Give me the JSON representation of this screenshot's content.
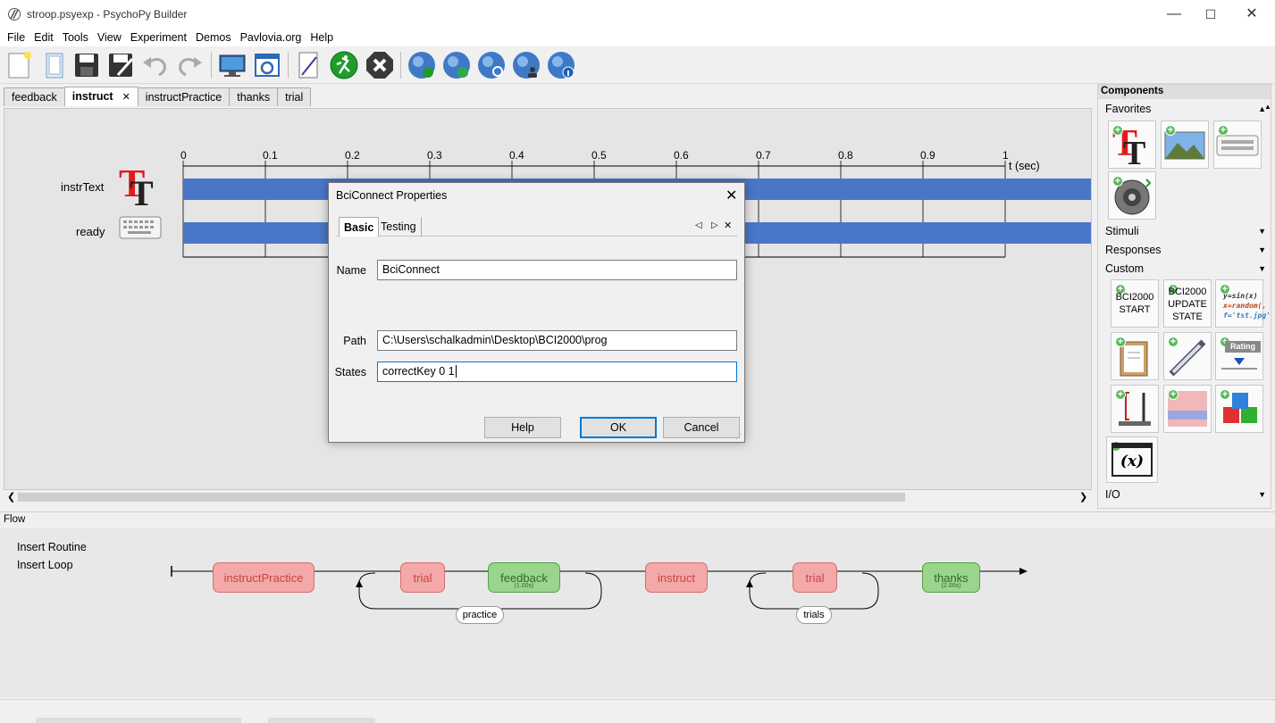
{
  "window": {
    "title": "stroop.psyexp - PsychoPy Builder",
    "min": "—",
    "max": "☐",
    "close": "✕"
  },
  "menu": [
    "File",
    "Edit",
    "Tools",
    "View",
    "Experiment",
    "Demos",
    "Pavlovia.org",
    "Help"
  ],
  "toolbar": [
    "new-file",
    "open-file",
    "save",
    "save-as",
    "undo",
    "redo",
    "monitor-center",
    "experiment-settings",
    "compile-script",
    "run",
    "stop",
    "pavlovia-sync",
    "pavlovia-search",
    "pavlovia-upload",
    "pavlovia-user",
    "pavlovia-info"
  ],
  "routine_tabs": [
    {
      "label": "feedback",
      "active": false
    },
    {
      "label": "instruct",
      "active": true,
      "close": "✕"
    },
    {
      "label": "instructPractice",
      "active": false
    },
    {
      "label": "thanks",
      "active": false
    },
    {
      "label": "trial",
      "active": false
    }
  ],
  "timeline": {
    "ticks": [
      "0",
      "0.1",
      "0.2",
      "0.3",
      "0.4",
      "0.5",
      "0.6",
      "0.7",
      "0.8",
      "0.9",
      "1"
    ],
    "unit_label": "t (sec)",
    "components": [
      {
        "name": "instrText",
        "icon": "text-icon"
      },
      {
        "name": "ready",
        "icon": "keyboard-icon"
      }
    ],
    "bar_color": "#4a76c8"
  },
  "components_panel": {
    "header": "Components",
    "categories": {
      "favorites": "Favorites",
      "stimuli": "Stimuli",
      "responses": "Responses",
      "custom": "Custom",
      "io": "I/O"
    },
    "bci_start": [
      "BCI2000",
      "START"
    ],
    "bci_update": [
      "BCI2000",
      "UPDATE",
      "STATE"
    ],
    "code_text": [
      "y=sin(x)",
      "x=random(,",
      "f='tst.jpg'"
    ],
    "rating_label": "Rating",
    "variable_label": "(x)"
  },
  "flow": {
    "header": "Flow",
    "insert_routine": "Insert Routine",
    "insert_loop": "Insert Loop",
    "routines": [
      {
        "label": "instructPractice",
        "color": "red"
      },
      {
        "label": "trial",
        "color": "red"
      },
      {
        "label": "feedback",
        "color": "green",
        "sub": "(1.00s)"
      },
      {
        "label": "instruct",
        "color": "red"
      },
      {
        "label": "trial",
        "color": "red"
      },
      {
        "label": "thanks",
        "color": "green",
        "sub": "(2.00s)"
      }
    ],
    "loops": [
      "practice",
      "trials"
    ]
  },
  "dialog": {
    "title": "BciConnect Properties",
    "close": "✕",
    "tabs": [
      "Basic",
      "Testing"
    ],
    "nav": [
      "◁",
      "▷",
      "✕"
    ],
    "fields": {
      "name_label": "Name",
      "name_value": "BciConnect",
      "path_label": "Path",
      "path_value": "C:\\Users\\schalkadmin\\Desktop\\BCI2000\\prog",
      "states_label": "States",
      "states_value": "correctKey 0 1"
    },
    "buttons": {
      "help": "Help",
      "ok": "OK",
      "cancel": "Cancel"
    }
  }
}
